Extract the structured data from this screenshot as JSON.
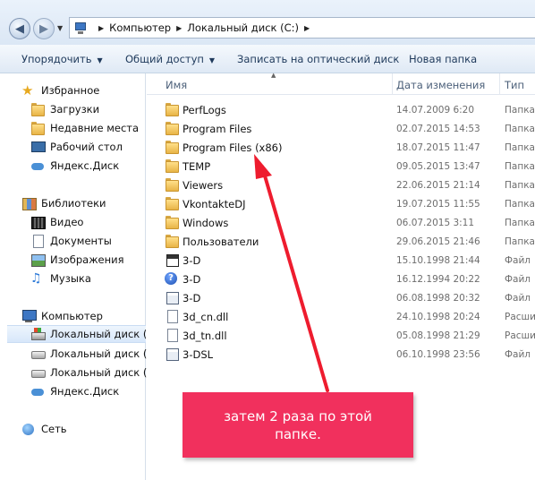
{
  "address": {
    "crumbs": [
      "Компьютер",
      "Локальный диск (C:)"
    ],
    "icon": "computer-icon"
  },
  "toolbar": {
    "organize": "Упорядочить",
    "share": "Общий доступ",
    "burn": "Записать на оптический диск",
    "new_folder": "Новая папка"
  },
  "navpane": {
    "favorites": {
      "label": "Избранное",
      "items": [
        "Загрузки",
        "Недавние места",
        "Рабочий стол",
        "Яндекс.Диск"
      ]
    },
    "libraries": {
      "label": "Библиотеки",
      "items": [
        "Видео",
        "Документы",
        "Изображения",
        "Музыка"
      ]
    },
    "computer": {
      "label": "Компьютер",
      "items": [
        "Локальный диск (C",
        "Локальный диск (D",
        "Локальный диск (E:",
        "Яндекс.Диск"
      ]
    },
    "network": {
      "label": "Сеть"
    }
  },
  "columns": {
    "name": "Имя",
    "date": "Дата изменения",
    "type": "Тип"
  },
  "files": [
    {
      "name": "PerfLogs",
      "date": "14.07.2009 6:20",
      "type": "Папка",
      "icon": "folder"
    },
    {
      "name": "Program Files",
      "date": "02.07.2015 14:53",
      "type": "Папка",
      "icon": "folder"
    },
    {
      "name": "Program Files (x86)",
      "date": "18.07.2015 11:47",
      "type": "Папка",
      "icon": "folder"
    },
    {
      "name": "TEMP",
      "date": "09.05.2015 13:47",
      "type": "Папка",
      "icon": "folder"
    },
    {
      "name": "Viewers",
      "date": "22.06.2015 21:14",
      "type": "Папка",
      "icon": "folder"
    },
    {
      "name": "VkontakteDJ",
      "date": "19.07.2015 11:55",
      "type": "Папка",
      "icon": "folder"
    },
    {
      "name": "Windows",
      "date": "06.07.2015 3:11",
      "type": "Папка",
      "icon": "folder"
    },
    {
      "name": "Пользователи",
      "date": "29.06.2015 21:46",
      "type": "Папка",
      "icon": "folder"
    },
    {
      "name": "3-D",
      "date": "15.10.1998 21:44",
      "type": "Файл",
      "icon": "blackwin"
    },
    {
      "name": "3-D",
      "date": "16.12.1994 20:22",
      "type": "Файл",
      "icon": "help"
    },
    {
      "name": "3-D",
      "date": "06.08.1998 20:32",
      "type": "Файл",
      "icon": "exe"
    },
    {
      "name": "3d_cn.dll",
      "date": "24.10.1998 20:24",
      "type": "Расши",
      "icon": "doc"
    },
    {
      "name": "3d_tn.dll",
      "date": "05.08.1998 21:29",
      "type": "Расши",
      "icon": "doc"
    },
    {
      "name": "3-DSL",
      "date": "06.10.1998 23:56",
      "type": "Файл",
      "icon": "exe"
    }
  ],
  "annotation": {
    "text": "затем 2 раза по этой папке.",
    "color": "#f1305d"
  }
}
